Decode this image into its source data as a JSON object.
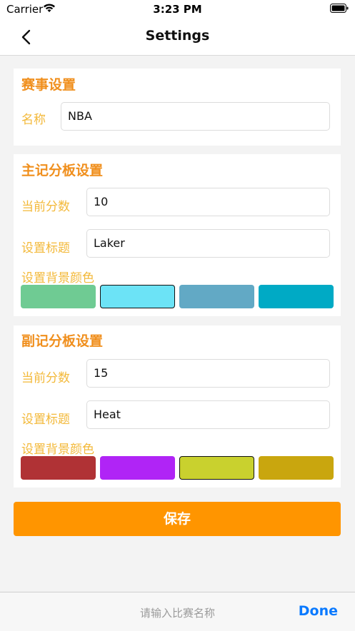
{
  "status_bar": {
    "carrier": "Carrier",
    "time": "3:23 PM"
  },
  "nav": {
    "title": "Settings",
    "back_icon": "chevron-left-icon"
  },
  "event": {
    "title": "赛事设置",
    "name_label": "名称",
    "name_value": "NBA"
  },
  "home": {
    "title": "主记分板设置",
    "score_label": "当前分数",
    "score_value": "10",
    "team_label": "设置标题",
    "team_value": "Laker",
    "bg_label": "设置背景颜色",
    "colors": [
      "#6fcb93",
      "#6ce3f6",
      "#62a9c5",
      "#00aac5"
    ],
    "selected_index": 1
  },
  "away": {
    "title": "副记分板设置",
    "score_label": "当前分数",
    "score_value": "15",
    "team_label": "设置标题",
    "team_value": "Heat",
    "bg_label": "设置背景颜色",
    "colors": [
      "#b03235",
      "#b024f6",
      "#c9d12e",
      "#c9a60e"
    ],
    "selected_index": 2
  },
  "save_label": "保存",
  "keyboard_toolbar": {
    "placeholder": "请输入比赛名称",
    "done_label": "Done"
  },
  "accent_colors": {
    "title_orange": "#f08f1d",
    "label_yellow": "#f3b93a",
    "button_orange": "#ff9500",
    "done_blue": "#0a7aff"
  }
}
